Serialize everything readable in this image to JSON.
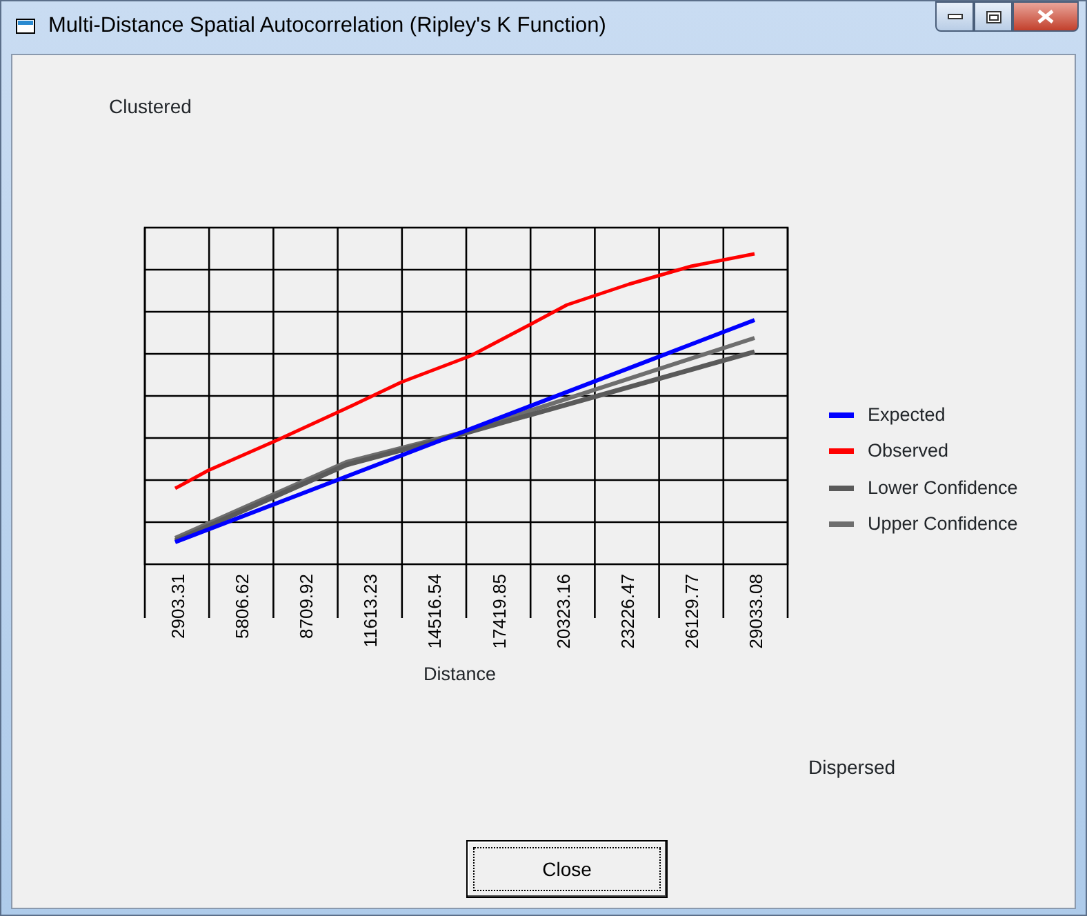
{
  "window": {
    "title": "Multi-Distance Spatial Autocorrelation (Ripley's K Function)"
  },
  "top_label": "Clustered",
  "chart": {
    "categories": [
      "2903.31",
      "5806.62",
      "8709.92",
      "11613.23",
      "14516.54",
      "17419.85",
      "20323.16",
      "23226.47",
      "26129.77",
      "29033.08"
    ],
    "xlabel": "Distance"
  },
  "legend": [
    {
      "label": "Expected",
      "color": "#0000ff"
    },
    {
      "label": "Observed",
      "color": "#ff0000"
    },
    {
      "label": "Lower Confidence",
      "color": "#5a5a5a"
    },
    {
      "label": "Upper Confidence",
      "color": "#6e6e6e"
    }
  ],
  "bottom_label": "Dispersed",
  "buttons": [
    "Close"
  ]
}
